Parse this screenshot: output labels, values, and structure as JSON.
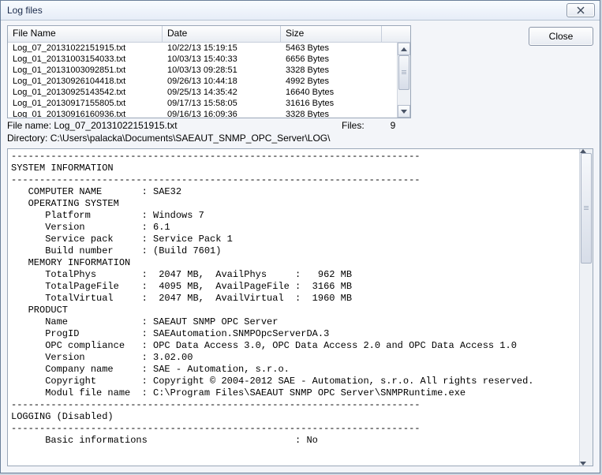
{
  "window": {
    "title": "Log files"
  },
  "buttons": {
    "close": "Close"
  },
  "table": {
    "headers": {
      "name": "File Name",
      "date": "Date",
      "size": "Size"
    },
    "rows": [
      {
        "name": "Log_07_20131022151915.txt",
        "date": "10/22/13 15:19:15",
        "size": "5463 Bytes"
      },
      {
        "name": "Log_01_20131003154033.txt",
        "date": "10/03/13 15:40:33",
        "size": "6656 Bytes"
      },
      {
        "name": "Log_01_20131003092851.txt",
        "date": "10/03/13 09:28:51",
        "size": "3328 Bytes"
      },
      {
        "name": "Log_01_20130926104418.txt",
        "date": "09/26/13 10:44:18",
        "size": "4992 Bytes"
      },
      {
        "name": "Log_01_20130925143542.txt",
        "date": "09/25/13 14:35:42",
        "size": "16640 Bytes"
      },
      {
        "name": "Log_01_20130917155805.txt",
        "date": "09/17/13 15:58:05",
        "size": "31616 Bytes"
      },
      {
        "name": "Log_01_20130916160936.txt",
        "date": "09/16/13 16:09:36",
        "size": "3328 Bytes"
      }
    ]
  },
  "info": {
    "filename_label": "File name:",
    "filename_value": "Log_07_20131022151915.txt",
    "files_label": "Files:",
    "files_value": "9",
    "directory_label": "Directory:",
    "directory_value": "C:\\Users\\palacka\\Documents\\SAEAUT_SNMP_OPC_Server\\LOG\\"
  },
  "log_text": "------------------------------------------------------------------------\nSYSTEM INFORMATION\n------------------------------------------------------------------------\n   COMPUTER NAME       : SAE32\n   OPERATING SYSTEM\n      Platform         : Windows 7\n      Version          : 6.1\n      Service pack     : Service Pack 1\n      Build number     : (Build 7601)\n   MEMORY INFORMATION\n      TotalPhys        :  2047 MB,  AvailPhys     :   962 MB\n      TotalPageFile    :  4095 MB,  AvailPageFile :  3166 MB\n      TotalVirtual     :  2047 MB,  AvailVirtual  :  1960 MB\n   PRODUCT\n      Name             : SAEAUT SNMP OPC Server\n      ProgID           : SAEAutomation.SNMPOpcServerDA.3\n      OPC compliance   : OPC Data Access 3.0, OPC Data Access 2.0 and OPC Data Access 1.0\n      Version          : 3.02.00\n      Company name     : SAE - Automation, s.r.o.\n      Copyright        : Copyright © 2004-2012 SAE - Automation, s.r.o. All rights reserved.\n      Modul file name  : C:\\Program Files\\SAEAUT SNMP OPC Server\\SNMPRuntime.exe\n------------------------------------------------------------------------\nLOGGING (Disabled)\n------------------------------------------------------------------------\n      Basic informations                          : No"
}
